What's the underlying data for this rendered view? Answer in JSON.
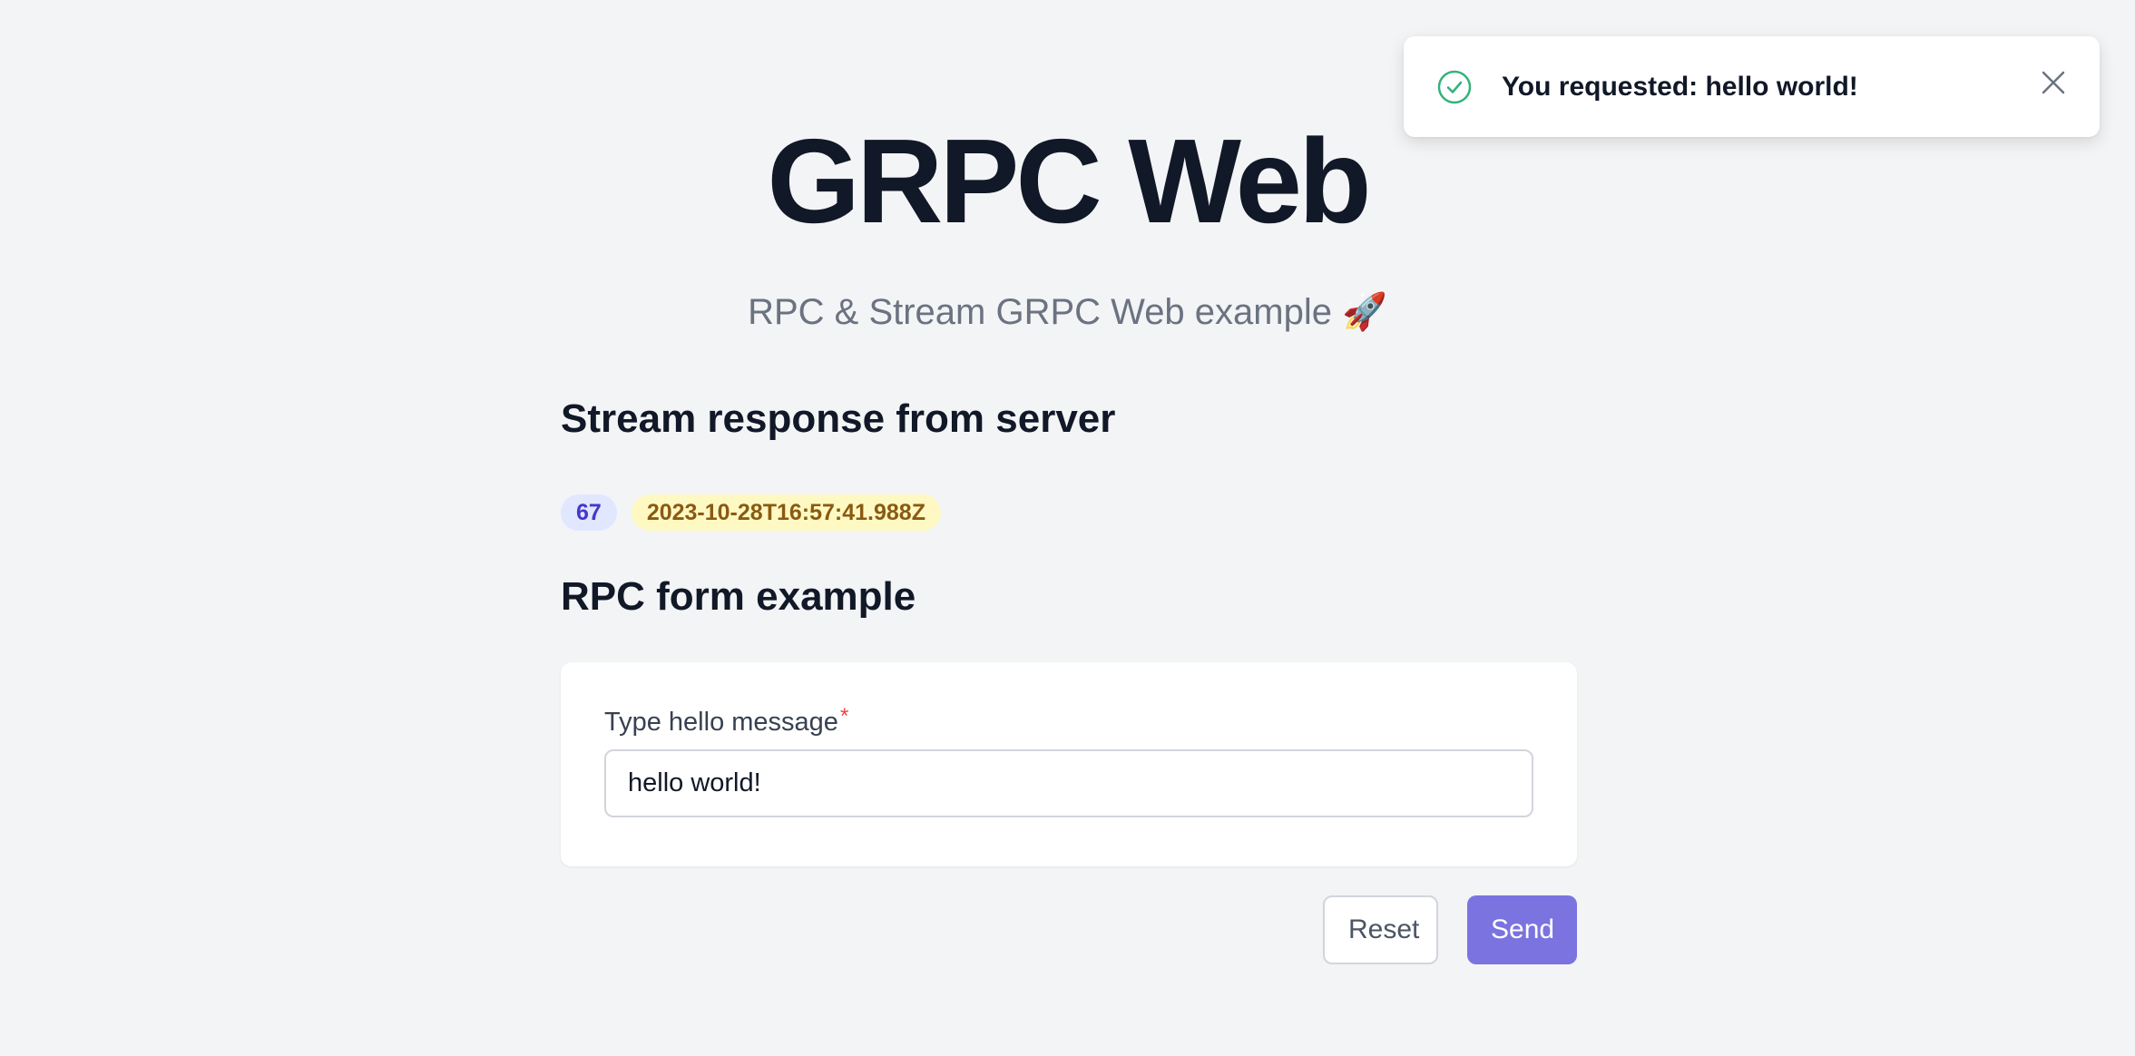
{
  "header": {
    "title": "GRPC Web",
    "subtitle": "RPC & Stream GRPC Web example 🚀"
  },
  "stream": {
    "heading": "Stream response from server",
    "count_badge": "67",
    "timestamp_badge": "2023-10-28T16:57:41.988Z"
  },
  "rpc_form": {
    "heading": "RPC form example",
    "field_label": "Type hello message",
    "required_mark": "*",
    "field_value": "hello world!",
    "reset_label": "Reset",
    "send_label": "Send"
  },
  "toast": {
    "message": "You requested: hello world!",
    "icon": "check-circle-icon",
    "close_icon": "close-icon"
  },
  "colors": {
    "background": "#f3f4f6",
    "accent": "#7b73e0",
    "success": "#34b27b",
    "required": "#ef4444",
    "count_badge_bg": "#e0e7ff",
    "timestamp_badge_bg": "#fef9c3"
  }
}
